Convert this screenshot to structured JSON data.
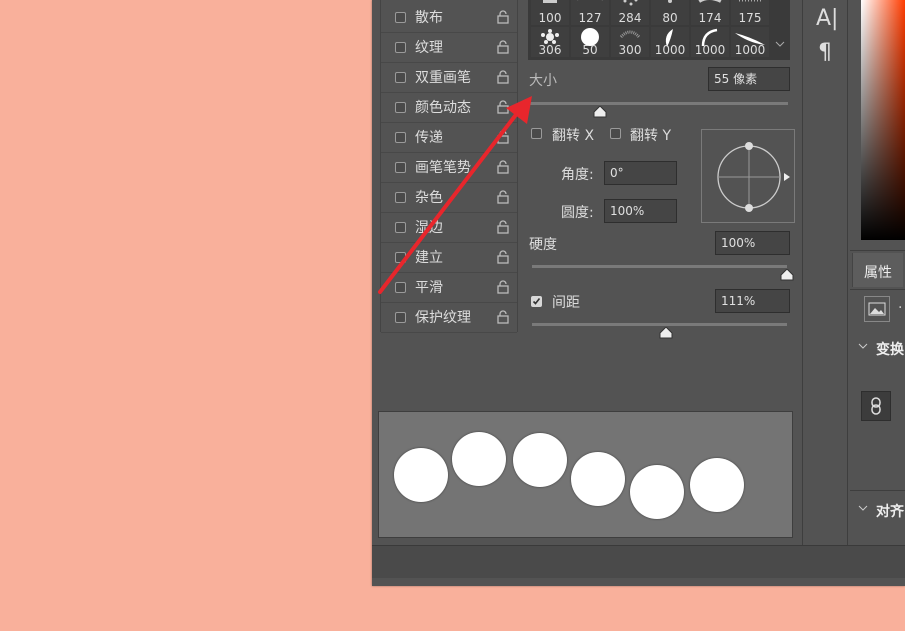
{
  "brushes": {
    "row1": [
      "100",
      "127",
      "284",
      "80",
      "174",
      "175"
    ],
    "row2": [
      "306",
      "50",
      "300",
      "1000",
      "1000",
      "1000"
    ]
  },
  "settings_list": [
    {
      "label": "散布",
      "checked": false
    },
    {
      "label": "纹理",
      "checked": false
    },
    {
      "label": "双重画笔",
      "checked": false
    },
    {
      "label": "颜色动态",
      "checked": false
    },
    {
      "label": "传递",
      "checked": false
    },
    {
      "label": "画笔笔势",
      "checked": false
    },
    {
      "label": "杂色",
      "checked": false
    },
    {
      "label": "湿边",
      "checked": false
    },
    {
      "label": "建立",
      "checked": false
    },
    {
      "label": "平滑",
      "checked": false
    },
    {
      "label": "保护纹理",
      "checked": false
    }
  ],
  "brush_options": {
    "size_label": "大小",
    "size_value": "55 像素",
    "flip_x_label": "翻转 X",
    "flip_y_label": "翻转 Y",
    "angle_label": "角度:",
    "angle_value": "0°",
    "roundness_label": "圆度:",
    "roundness_value": "100%",
    "hardness_label": "硬度",
    "hardness_value": "100%",
    "spacing_label": "间距",
    "spacing_value": "111%",
    "spacing_checked": true,
    "size_slider": 0.27,
    "hardness_slider": 1.0,
    "spacing_slider": 0.53
  },
  "tools": {
    "char_icon": "A|",
    "para_icon": "¶"
  },
  "right_panel": {
    "properties_tab": "属性",
    "transform_section": "变换",
    "align_section": "对齐"
  },
  "colors": {
    "background": "#f9b09b",
    "panel": "#535353",
    "arrow": "#e8262c"
  }
}
